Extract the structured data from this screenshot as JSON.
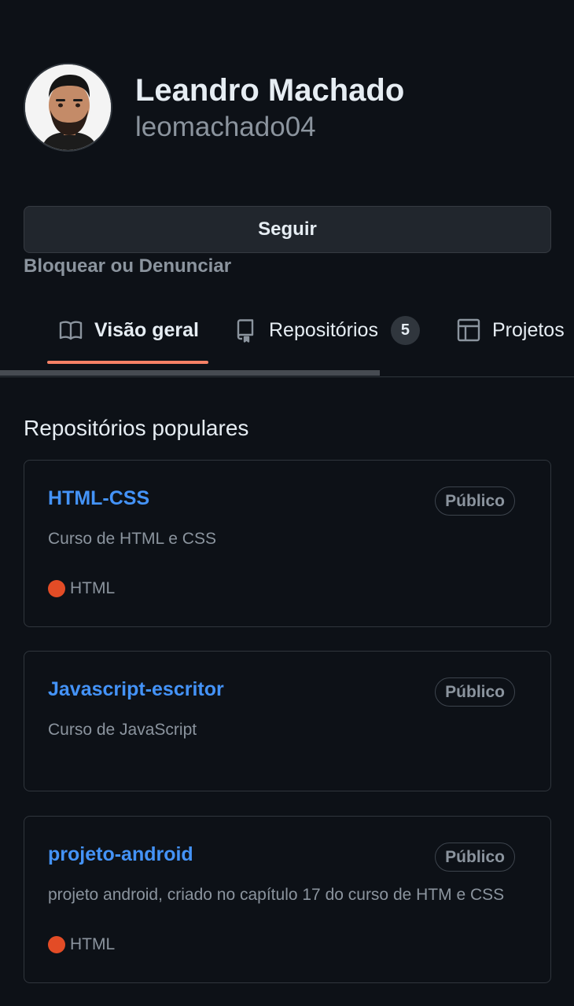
{
  "profile": {
    "full_name": "Leandro Machado",
    "username": "leomachado04"
  },
  "actions": {
    "follow_label": "Seguir",
    "block_label": "Bloquear ou Denunciar"
  },
  "tabs": [
    {
      "label": "Visão geral",
      "icon": "book-icon",
      "active": true
    },
    {
      "label": "Repositórios",
      "icon": "repo-icon",
      "count": "5"
    },
    {
      "label": "Projetos",
      "icon": "table-icon"
    }
  ],
  "popular": {
    "title": "Repositórios populares",
    "repos": [
      {
        "name": "HTML-CSS",
        "visibility": "Público",
        "description": "Curso de HTML e CSS",
        "language": "HTML"
      },
      {
        "name": "Javascript-escritor",
        "visibility": "Público",
        "description": "Curso de JavaScript"
      },
      {
        "name": "projeto-android",
        "visibility": "Público",
        "description": "projeto android, criado no capítulo 17 do curso de HTM e CSS",
        "language": "HTML"
      }
    ]
  },
  "colors": {
    "background": "#0d1117",
    "link": "#4493f8",
    "active_tab": "#f78166",
    "html_language": "#e34c26"
  }
}
